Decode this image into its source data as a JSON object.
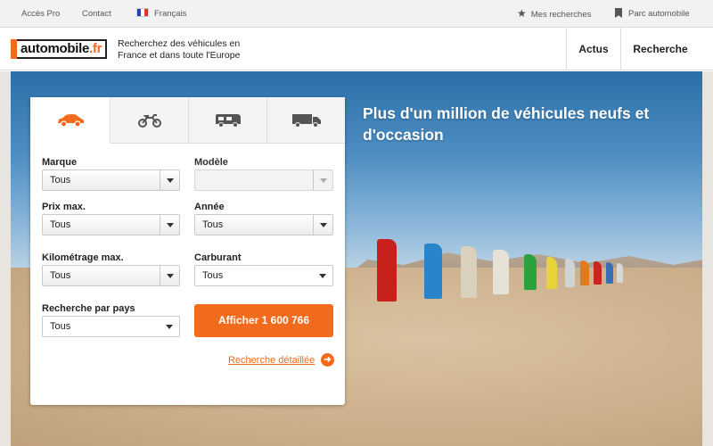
{
  "topbar": {
    "acces_pro": "Accès Pro",
    "contact": "Contact",
    "language": "Français",
    "my_searches": "Mes recherches",
    "fleet": "Parc automobile"
  },
  "header": {
    "logo_text": "automobile",
    "logo_suffix": ".fr",
    "tagline": "Recherchez des véhicules en France et dans toute l'Europe",
    "nav_actus": "Actus",
    "nav_recherche": "Recherche"
  },
  "hero": {
    "title": "Plus d'un million de véhicules neufs et d'occasion"
  },
  "search": {
    "tabs": [
      {
        "icon": "car-icon",
        "active": true
      },
      {
        "icon": "motorcycle-icon",
        "active": false
      },
      {
        "icon": "camper-icon",
        "active": false
      },
      {
        "icon": "truck-icon",
        "active": false
      }
    ],
    "marque_label": "Marque",
    "marque_value": "Tous",
    "modele_label": "Modèle",
    "modele_value": "",
    "prix_label": "Prix max.",
    "prix_value": "Tous",
    "annee_label": "Année",
    "annee_value": "Tous",
    "km_label": "Kilométrage max.",
    "km_value": "Tous",
    "carburant_label": "Carburant",
    "carburant_value": "Tous",
    "pays_label": "Recherche par pays",
    "pays_value": "Tous",
    "submit_label": "Afficher 1 600 766",
    "advanced_label": "Recherche détaillée"
  },
  "colors": {
    "accent": "#f26a1b",
    "sky": "#4d8dc2",
    "sand": "#cdb08d"
  }
}
